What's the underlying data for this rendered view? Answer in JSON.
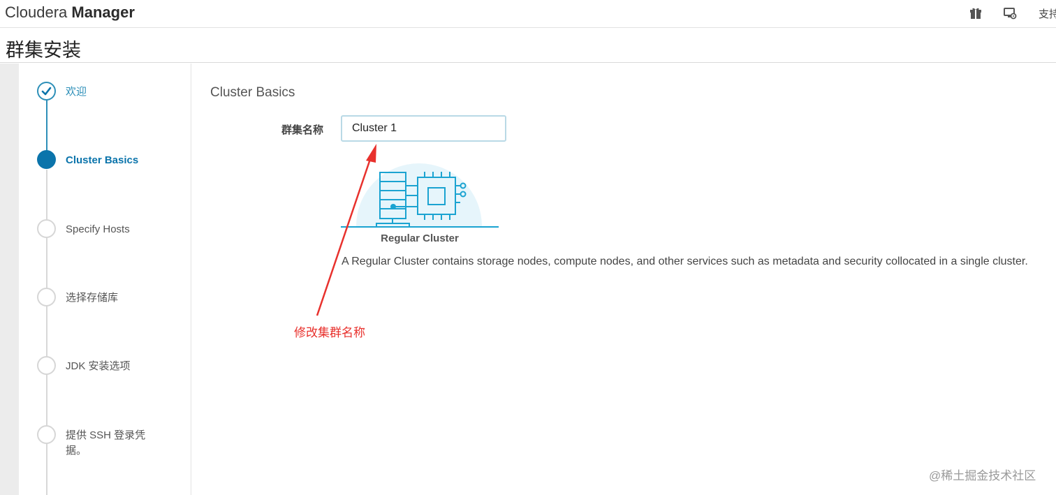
{
  "header": {
    "brand_light": "Cloudera",
    "brand_bold": "Manager",
    "icons": [
      "gift-icon",
      "screen-gear-icon"
    ],
    "support_label": "支持"
  },
  "page": {
    "title": "群集安装"
  },
  "wizard": {
    "steps": [
      {
        "label": "欢迎",
        "state": "done"
      },
      {
        "label": "Cluster Basics",
        "state": "active"
      },
      {
        "label": "Specify Hosts",
        "state": "pending"
      },
      {
        "label": "选择存储库",
        "state": "pending"
      },
      {
        "label": "JDK 安装选项",
        "state": "pending"
      },
      {
        "label": "提供 SSH 登录凭据。",
        "state": "pending"
      }
    ]
  },
  "main": {
    "section_title": "Cluster Basics",
    "cluster_name_label": "群集名称",
    "cluster_name_value": "Cluster 1",
    "cluster_type_label": "Regular Cluster",
    "cluster_type_desc": "A Regular Cluster contains storage nodes, compute nodes, and other services such as metadata and security collocated in a single cluster."
  },
  "annotation": {
    "text": "修改集群名称"
  },
  "watermark": "@稀土掘金技术社区",
  "colors": {
    "accent": "#0b74ab",
    "done": "#2d8fb8",
    "annotation": "#e8312d",
    "illustration": "#1aa3d1"
  }
}
